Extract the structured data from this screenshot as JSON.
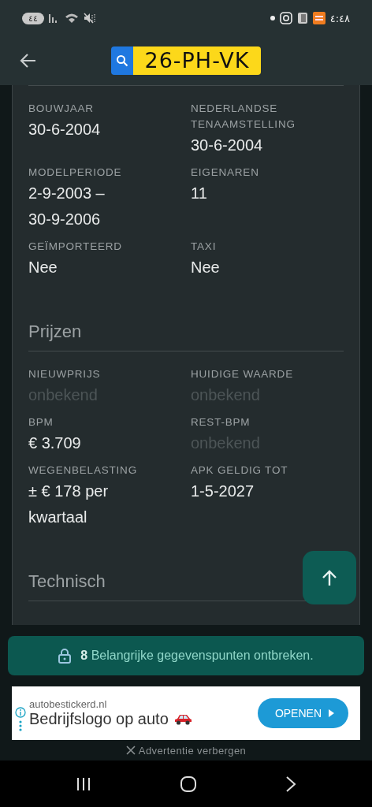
{
  "status_bar": {
    "battery": "٤٤",
    "time": "٤:٤٨"
  },
  "header": {
    "plate": "26-PH-VK"
  },
  "sections": [
    {
      "fields": [
        {
          "label": "BOUWJAAR",
          "value": "30-6-2004",
          "unknown": false
        },
        {
          "label": "NEDERLANDSE TENAAMSTELLING",
          "value": "30-6-2004",
          "unknown": false
        },
        {
          "label": "MODELPERIODE",
          "value": "2-9-2003 – 30-9-2006",
          "unknown": false
        },
        {
          "label": "EIGENAREN",
          "value": "11",
          "unknown": false
        },
        {
          "label": "GEÏMPORTEERD",
          "value": "Nee",
          "unknown": false
        },
        {
          "label": "TAXI",
          "value": "Nee",
          "unknown": false
        }
      ]
    },
    {
      "title": "Prijzen",
      "fields": [
        {
          "label": "NIEUWPRIJS",
          "value": "onbekend",
          "unknown": true
        },
        {
          "label": "HUIDIGE WAARDE",
          "value": "onbekend",
          "unknown": true
        },
        {
          "label": "BPM",
          "value": "€ 3.709",
          "unknown": false
        },
        {
          "label": "REST-BPM",
          "value": "onbekend",
          "unknown": true
        },
        {
          "label": "WEGENBELASTING",
          "value": "± € 178 per kwartaal",
          "unknown": false
        },
        {
          "label": "APK GELDIG TOT",
          "value": "1-5-2027",
          "unknown": false
        }
      ]
    },
    {
      "title": "Technisch"
    }
  ],
  "notice": "**8** Belangrijke gegevenspunten ontbreken.",
  "ad": {
    "domain": "autobestickerd.nl",
    "headline": "Bedrijfslogo op auto",
    "button": "OPENEN",
    "hide": "Advertentie verbergen"
  }
}
